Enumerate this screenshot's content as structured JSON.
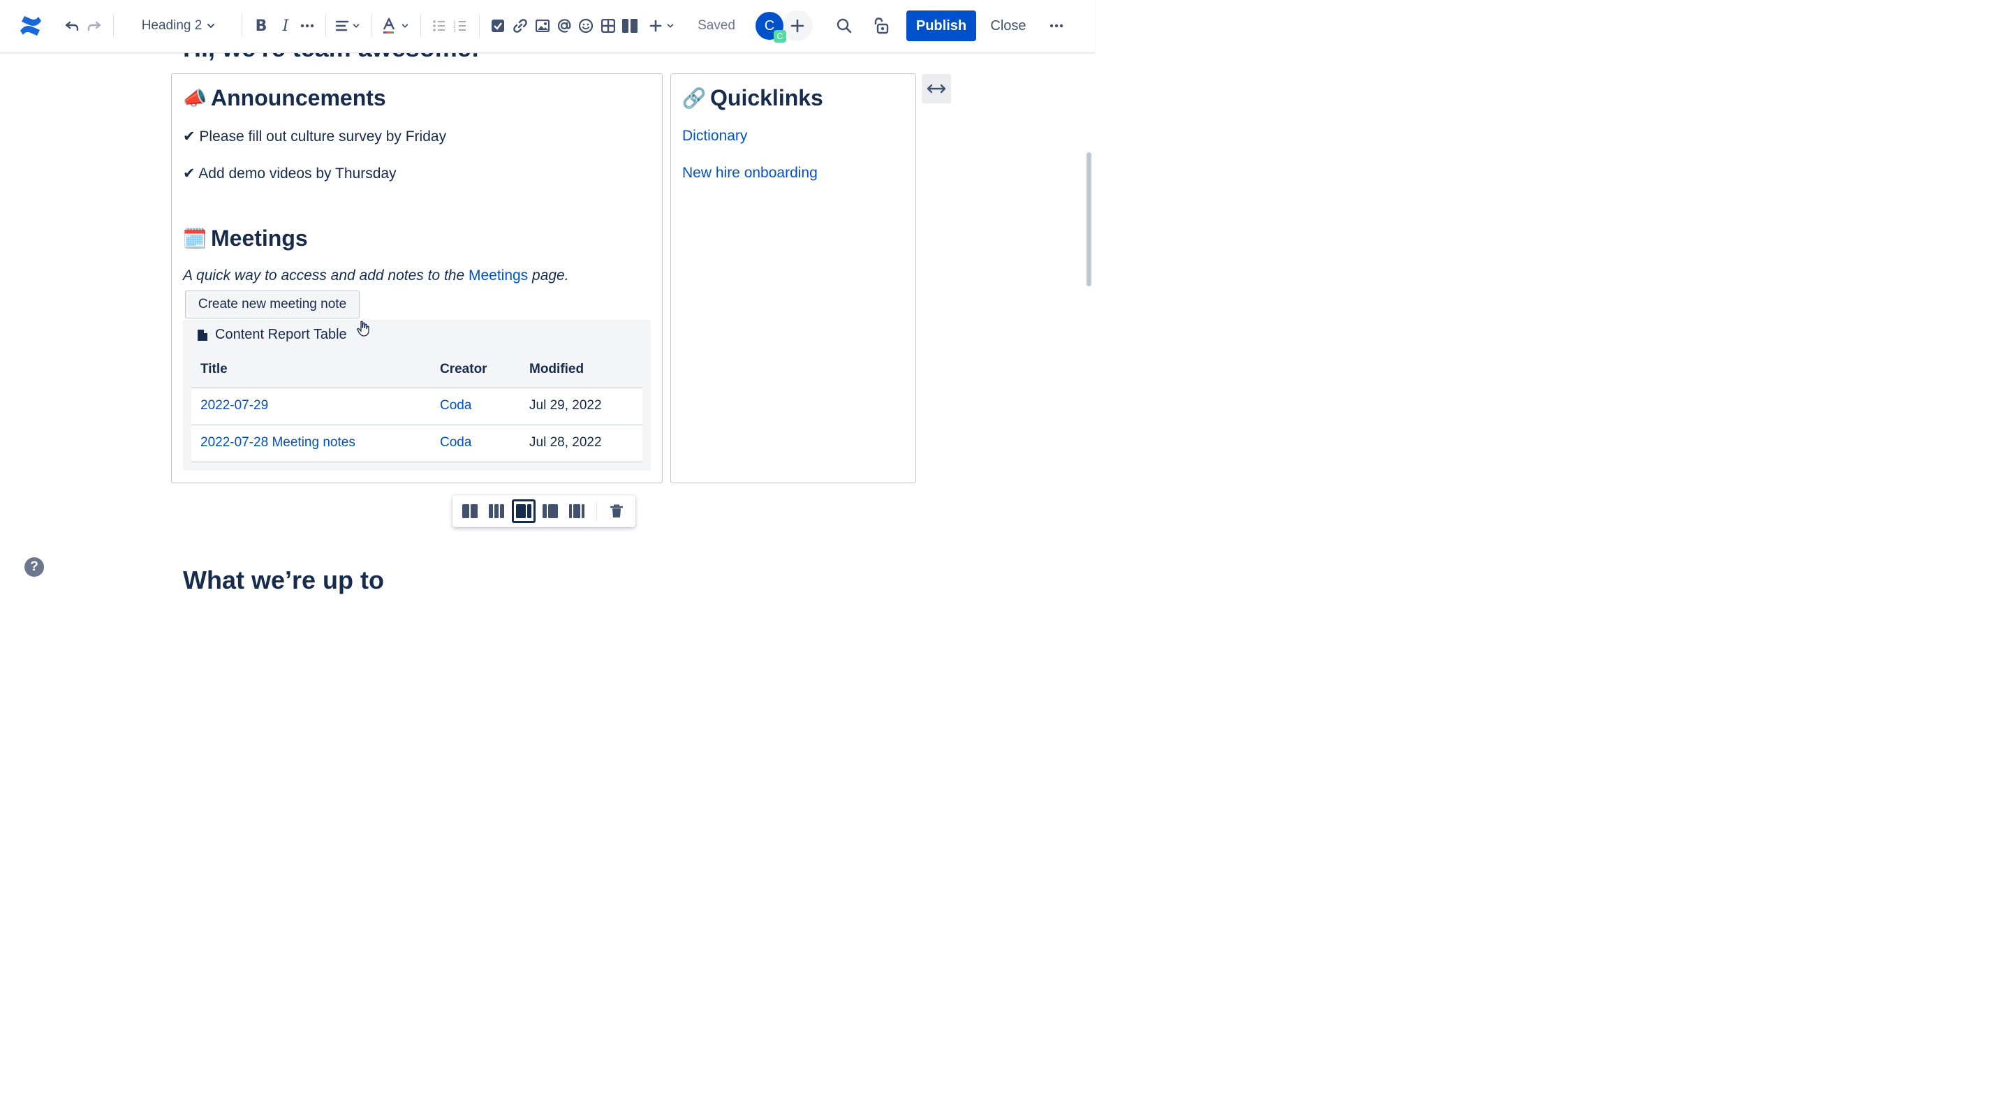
{
  "toolbar": {
    "heading_select": "Heading 2",
    "saved_status": "Saved",
    "avatar_initial": "C",
    "avatar_badge": "C",
    "publish_label": "Publish",
    "close_label": "Close",
    "colors": {
      "primary": "#0052cc",
      "badge": "#57d9a3",
      "text_color_accent": "#6554c0"
    }
  },
  "page": {
    "clipped_title": "Hi, we're team awesome!",
    "announcements": {
      "emoji": "📣",
      "heading": "Announcements",
      "items": [
        "✔ Please fill out culture survey by Friday",
        "✔ Add demo videos by Thursday"
      ]
    },
    "meetings": {
      "emoji": "🗓️",
      "heading": "Meetings",
      "desc_prefix": "A quick way to access and add notes to the ",
      "desc_link": "Meetings",
      "desc_suffix": " page.",
      "create_button": "Create new meeting note",
      "report": {
        "title": "Content Report Table",
        "columns": [
          "Title",
          "Creator",
          "Modified"
        ],
        "rows": [
          {
            "title": "2022-07-29",
            "creator": "Coda",
            "modified": "Jul 29, 2022"
          },
          {
            "title": "2022-07-28 Meeting notes",
            "creator": "Coda",
            "modified": "Jul 28, 2022"
          }
        ]
      }
    },
    "quicklinks": {
      "emoji": "🔗",
      "heading": "Quicklinks",
      "links": [
        "Dictionary",
        "New hire onboarding"
      ]
    },
    "next_section_heading": "What we’re up to",
    "help_label": "?"
  }
}
